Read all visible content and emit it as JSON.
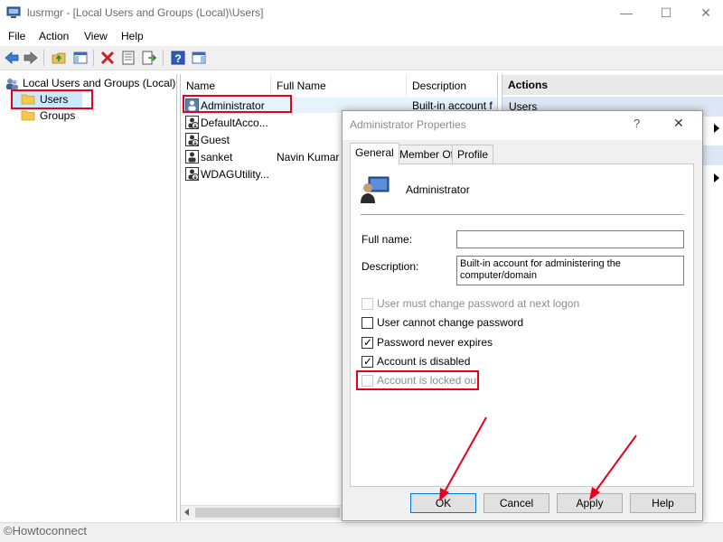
{
  "window": {
    "title": "lusrmgr - [Local Users and Groups (Local)\\Users]",
    "minimize_glyph": "—",
    "maximize_glyph": "☐",
    "close_glyph": "✕"
  },
  "menu": [
    "File",
    "Action",
    "View",
    "Help"
  ],
  "toolbar_icons": [
    "back-arrow-icon",
    "forward-arrow-icon",
    "up-folder-icon",
    "show-hide-tree-icon",
    "delete-icon",
    "properties-icon",
    "export-list-icon",
    "help-icon",
    "show-action-pane-icon"
  ],
  "tree": {
    "root": "Local Users and Groups (Local)",
    "items": [
      "Users",
      "Groups"
    ]
  },
  "list": {
    "columns": [
      "Name",
      "Full Name",
      "Description"
    ],
    "rows": [
      {
        "name": "Administrator",
        "full_name": "",
        "description": "Built-in account f"
      },
      {
        "name": "DefaultAcco...",
        "full_name": "",
        "description": ""
      },
      {
        "name": "Guest",
        "full_name": "",
        "description": ""
      },
      {
        "name": "sanket",
        "full_name": "Navin Kumar",
        "description": ""
      },
      {
        "name": "WDAGUtility...",
        "full_name": "",
        "description": ""
      }
    ]
  },
  "actions": {
    "header": "Actions",
    "first_item": "Users"
  },
  "dialog": {
    "title": "Administrator Properties",
    "help_glyph": "?",
    "close_glyph": "✕",
    "tabs": [
      "General",
      "Member Of",
      "Profile"
    ],
    "user_name": "Administrator",
    "full_name_label": "Full name:",
    "full_name_value": "",
    "description_label": "Description:",
    "description_value": "Built-in account for administering the computer/domain",
    "checkboxes": [
      {
        "label": "User must change password at next logon",
        "checked": false,
        "disabled": true
      },
      {
        "label": "User cannot change password",
        "checked": false,
        "disabled": false
      },
      {
        "label": "Password never expires",
        "checked": true,
        "disabled": false
      },
      {
        "label": "Account is disabled",
        "checked": true,
        "disabled": false
      },
      {
        "label": "Account is locked out",
        "checked": false,
        "disabled": true
      }
    ],
    "buttons": {
      "ok": "OK",
      "cancel": "Cancel",
      "apply": "Apply",
      "help": "Help"
    }
  },
  "check_glyph": "✓",
  "watermark": "©Howtoconnect",
  "colors": {
    "annotation_red": "#e8001c",
    "actions_band": "#dce6f4"
  }
}
